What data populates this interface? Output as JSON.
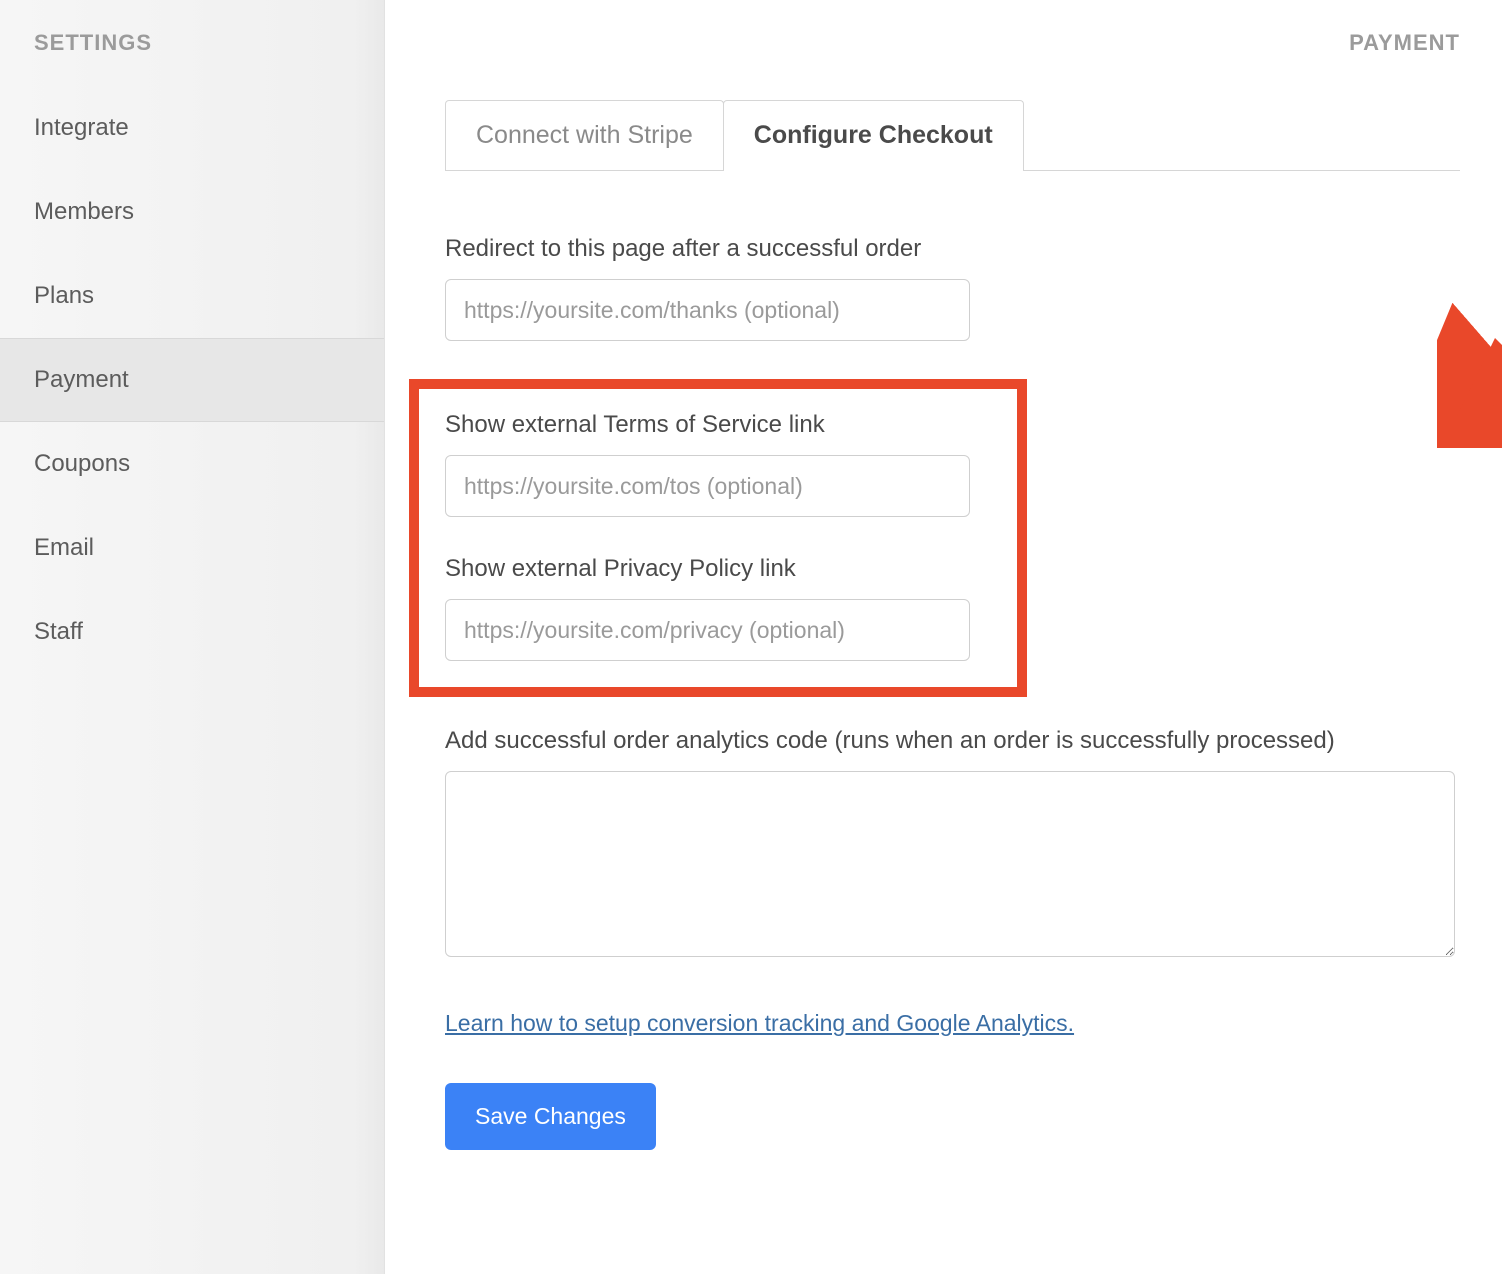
{
  "sidebar": {
    "title": "SETTINGS",
    "items": [
      {
        "label": "Integrate"
      },
      {
        "label": "Members"
      },
      {
        "label": "Plans"
      },
      {
        "label": "Payment"
      },
      {
        "label": "Coupons"
      },
      {
        "label": "Email"
      },
      {
        "label": "Staff"
      }
    ]
  },
  "header": {
    "page_title": "PAYMENT"
  },
  "tabs": {
    "connect": "Connect with Stripe",
    "configure": "Configure Checkout"
  },
  "form": {
    "redirect": {
      "label": "Redirect to this page after a successful order",
      "placeholder": "https://yoursite.com/thanks (optional)"
    },
    "tos": {
      "label": "Show external Terms of Service link",
      "placeholder": "https://yoursite.com/tos (optional)"
    },
    "privacy": {
      "label": "Show external Privacy Policy link",
      "placeholder": "https://yoursite.com/privacy (optional)"
    },
    "analytics": {
      "label": "Add successful order analytics code (runs when an order is successfully processed)"
    },
    "help_link": "Learn how to setup conversion tracking and Google Analytics.",
    "save_button": "Save Changes"
  }
}
